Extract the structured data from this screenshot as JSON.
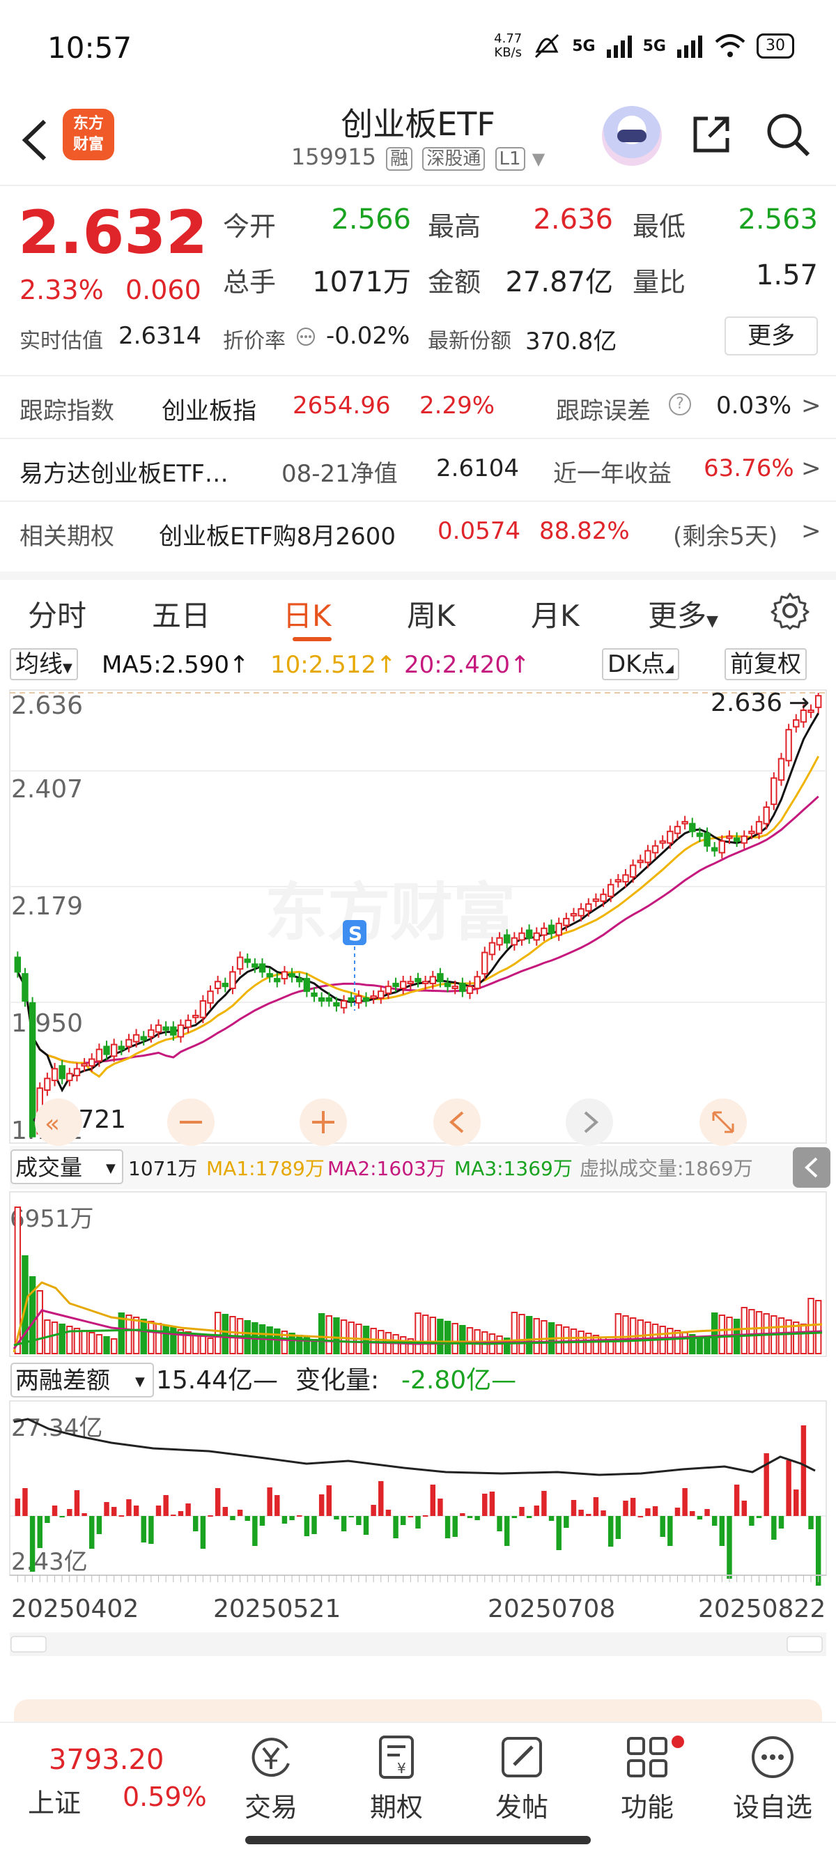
{
  "status": {
    "time": "10:57",
    "net_speed_value": "4.77",
    "net_speed_unit": "KB/s",
    "sig1": "5G",
    "sig2": "5G",
    "battery": "30"
  },
  "header": {
    "logo_line1": "东方",
    "logo_line2": "财富",
    "name": "创业板ETF",
    "code": "159915",
    "tag1": "融",
    "tag2": "深股通",
    "tag3": "L1"
  },
  "quote": {
    "price": "2.632",
    "change_pct": "2.33%",
    "change_val": "0.060",
    "open_label": "今开",
    "open": "2.566",
    "high_label": "最高",
    "high": "2.636",
    "low_label": "最低",
    "low": "2.563",
    "volume_label": "总手",
    "volume": "1071万",
    "amount_label": "金额",
    "amount": "27.87亿",
    "ratio_label": "量比",
    "ratio": "1.57",
    "est_label": "实时估值",
    "est": "2.6314",
    "premium_label": "折价率",
    "premium": "-0.02%",
    "shares_label": "最新份额",
    "shares": "370.8亿",
    "more_label": "更多"
  },
  "info": {
    "track_label": "跟踪指数",
    "track_name": "创业板指",
    "track_val": "2654.96",
    "track_pct": "2.29%",
    "err_label": "跟踪误差",
    "err_val": "0.03%",
    "fund_name": "易方达创业板ETF…",
    "nav_label": "08-21净值",
    "nav_val": "2.6104",
    "year_label": "近一年收益",
    "year_val": "63.76%",
    "opt_label": "相关期权",
    "opt_name": "创业板ETF购8月2600",
    "opt_price": "0.0574",
    "opt_pct": "88.82%",
    "opt_days": "(剩余5天)",
    "arrow": ">"
  },
  "tabs": [
    {
      "label": "分时"
    },
    {
      "label": "五日"
    },
    {
      "label": "日K"
    },
    {
      "label": "周K"
    },
    {
      "label": "月K"
    },
    {
      "label": "更多"
    }
  ],
  "ma": {
    "selector": "均线",
    "ma5": "MA5:2.590",
    "ma10": "10:2.512",
    "ma20": "20:2.420",
    "arrow": "↑",
    "dk": "DK点",
    "adjust": "前复权"
  },
  "chart_data": {
    "type": "candlestick",
    "price_ticks": [
      "2.636",
      "2.407",
      "2.179",
      "1.950",
      "1.721"
    ],
    "ylim": [
      1.721,
      2.636
    ],
    "max_label": "2.636",
    "min_label": "1.721",
    "watermark": "东方财富",
    "s_marker": "S",
    "x_ticks": [
      "20250402",
      "20250521",
      "20250708",
      "20250822"
    ],
    "close": [
      2.06,
      2.0,
      1.72,
      1.82,
      1.84,
      1.86,
      1.84,
      1.85,
      1.86,
      1.87,
      1.88,
      1.9,
      1.89,
      1.91,
      1.9,
      1.92,
      1.93,
      1.92,
      1.94,
      1.95,
      1.94,
      1.93,
      1.95,
      1.96,
      1.97,
      2.0,
      2.02,
      2.04,
      2.03,
      2.06,
      2.09,
      2.08,
      2.07,
      2.06,
      2.05,
      2.04,
      2.06,
      2.05,
      2.04,
      2.02,
      2.01,
      2.0,
      2.0,
      1.99,
      2.0,
      2.0,
      2.01,
      2.0,
      2.01,
      2.02,
      2.03,
      2.03,
      2.04,
      2.04,
      2.04,
      2.04,
      2.05,
      2.04,
      2.03,
      2.03,
      2.02,
      2.03,
      2.05,
      2.1,
      2.12,
      2.13,
      2.12,
      2.13,
      2.14,
      2.13,
      2.14,
      2.15,
      2.14,
      2.16,
      2.17,
      2.18,
      2.19,
      2.2,
      2.21,
      2.22,
      2.24,
      2.25,
      2.26,
      2.28,
      2.29,
      2.31,
      2.32,
      2.33,
      2.35,
      2.36,
      2.37,
      2.35,
      2.34,
      2.32,
      2.31,
      2.33,
      2.34,
      2.33,
      2.34,
      2.35,
      2.37,
      2.4,
      2.46,
      2.5,
      2.56,
      2.58,
      2.6,
      2.6,
      2.63
    ],
    "volume": {
      "label": "成交量",
      "value": "1071万",
      "ma1": "MA1:1789万",
      "ma2": "MA2:1603万",
      "ma3": "MA3:1369万",
      "virtual": "虚拟成交量:1869万",
      "max_label": "6951万"
    },
    "margin": {
      "label": "两融差额",
      "value": "15.44亿—",
      "change_label": "变化量:",
      "change": "-2.80亿—",
      "top_label": "27.34亿",
      "bottom_label": "2.43亿"
    },
    "colors": {
      "up": "#e0252a",
      "down": "#1aa321",
      "ma5": "#111111",
      "ma10": "#f0b400",
      "ma20": "#c5197d"
    }
  },
  "bottom_nav": {
    "index_value": "3793.20",
    "index_name": "上证",
    "index_change": "0.59%",
    "items": [
      {
        "label": "交易",
        "icon": "yen-circle-icon"
      },
      {
        "label": "期权",
        "icon": "document-yen-icon"
      },
      {
        "label": "发帖",
        "icon": "edit-icon"
      },
      {
        "label": "功能",
        "icon": "grid-icon"
      },
      {
        "label": "设自选",
        "icon": "more-circle-icon"
      }
    ]
  }
}
